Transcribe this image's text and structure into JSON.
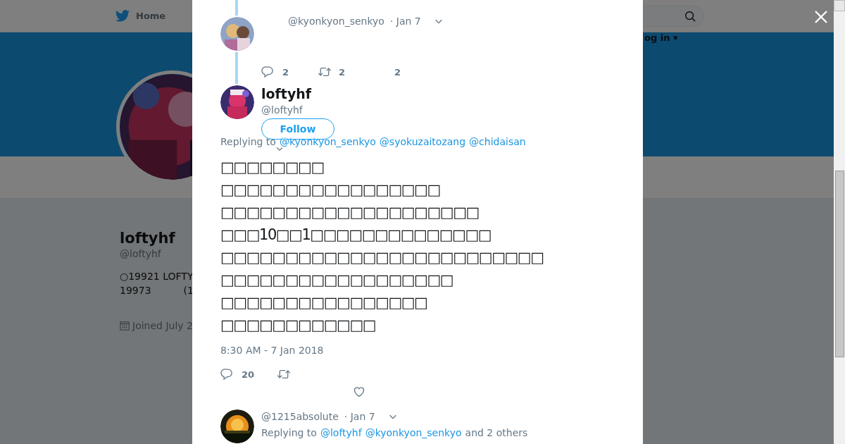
{
  "header": {
    "nav": [
      {
        "label": "Home"
      }
    ],
    "login": "og in ▾"
  },
  "profile": {
    "name": "loftyhf",
    "handle": "@loftyhf",
    "bio_lines": [
      [
        "○19921 LOFTY"
      ],
      [
        "19973",
        "(1"
      ]
    ],
    "joined": "Joined July 2"
  },
  "thread": {
    "parent": {
      "handle": "@kyonkyon_senkyo",
      "time": "· Jan 7",
      "replies": "2",
      "retweets": "2",
      "likes": "2"
    },
    "tweet": {
      "name": "loftyhf",
      "handle": "@loftyhf",
      "follow": "Follow",
      "replying_label": "Replying to",
      "replying_to": [
        "@kyonkyon_senkyo",
        "@syokuzaitozang",
        "@chidaisan"
      ],
      "text": "□□□□□□□□\n□□□□□□□□□□□□□□□□□\n□□□□□□□□□□□□□□□□□□□□\n□□□10□□1□□□□□□□□□□□□□□\n□□□□□□□□□□□□□□□□□□□□□□□□□\n□□□□□□□□□□□□□□□□□□\n□□□□□□□□□□□□□□□□\n□□□□□□□□□□□□",
      "timestamp": "8:30 AM - 7 Jan 2018",
      "replies": "20"
    },
    "replies": [
      {
        "handle": "@1215absolute",
        "time": "· Jan 7",
        "replying_label": "Replying to",
        "replying_to": [
          "@loftyhf",
          "@kyonkyon_senkyo"
        ],
        "replying_more": "and 2 others"
      }
    ]
  }
}
